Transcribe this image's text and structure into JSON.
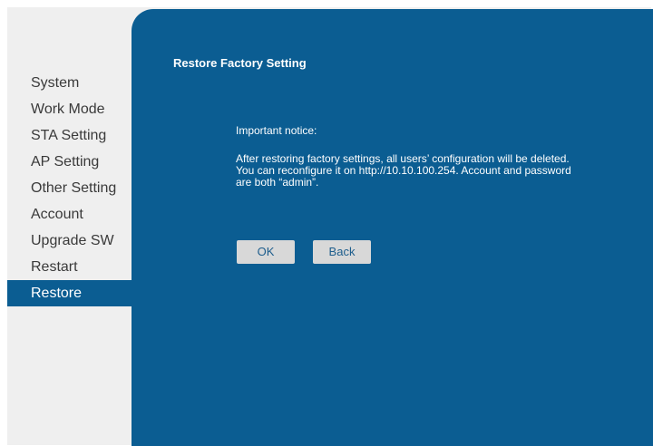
{
  "sidebar": {
    "items": [
      {
        "label": "System"
      },
      {
        "label": "Work Mode"
      },
      {
        "label": "STA Setting"
      },
      {
        "label": "AP Setting"
      },
      {
        "label": "Other Setting"
      },
      {
        "label": "Account"
      },
      {
        "label": "Upgrade SW"
      },
      {
        "label": "Restart"
      },
      {
        "label": "Restore",
        "active": true
      }
    ]
  },
  "main": {
    "title": "Restore Factory Setting",
    "notice_heading": "Important notice:",
    "notice_body": "After restoring factory settings, all users’ configuration will be deleted. You can reconfigure it on http://10.10.100.254. Account and password are both “admin”.",
    "ok_label": "OK",
    "back_label": "Back"
  },
  "colors": {
    "panel": "#0b5d92",
    "button": "#d8d8d8",
    "text_light": "#ffffff"
  }
}
